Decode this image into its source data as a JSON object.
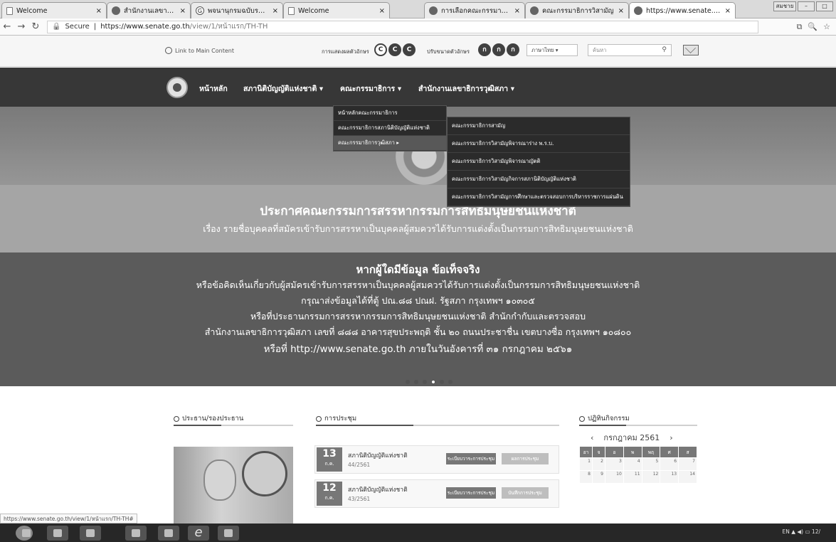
{
  "browser": {
    "tabs": [
      {
        "title": "Welcome",
        "active": false
      },
      {
        "title": "สำนักงานเลขาธิการวุ",
        "active": false
      },
      {
        "title": "พจนานุกรมฉบับราชบัณฑิตฯ",
        "active": false
      },
      {
        "title": "Welcome",
        "active": false
      },
      {
        "title": "การเลือกคณะกรรมาธิการฯ",
        "active": false
      },
      {
        "title": "คณะกรรมาธิการวิสามัญ",
        "active": false
      },
      {
        "title": "https://www.senate.go",
        "active": true
      }
    ],
    "profile_label": "สมชาย",
    "url_secure": "Secure",
    "url_host": "https://www.senate.go.th",
    "url_path": "/view/1/หน้าแรก/TH-TH"
  },
  "util": {
    "skip_link": "Link to Main Content",
    "font_label": "การแสดงผลตัวอักษร",
    "font_btns": [
      "C",
      "C",
      "C"
    ],
    "contrast_label": "ปรับขนาดตัวอักษร",
    "contrast_btns": [
      "ก",
      "ก",
      "ก"
    ],
    "language": "ภาษาไทย",
    "search_placeholder": "ค้นหา"
  },
  "nav": {
    "items": [
      "หน้าหลัก",
      "สภานิติบัญญัติแห่งชาติ ▾",
      "คณะกรรมาธิการ ▾",
      "สำนักงานเลขาธิการวุฒิสภา ▾"
    ]
  },
  "dropdown": {
    "level1": [
      "หน้าหลักคณะกรรมาธิการ",
      "คณะกรรมาธิการสภานิติบัญญัติแห่งชาติ",
      "คณะกรรมาธิการวุฒิสภา ▸"
    ],
    "level2": [
      "คณะกรรมาธิการสามัญ",
      "คณะกรรมาธิการวิสามัญพิจารณาร่าง พ.ร.บ.",
      "คณะกรรมาธิการวิสามัญพิจารณาญัตติ",
      "คณะกรรมาธิการวิสามัญกิจการสภานิติบัญญัติแห่งชาติ",
      "คณะกรรมาธิการวิสามัญการศึกษาและตรวจสอบการบริหารราชการแผ่นดิน"
    ]
  },
  "hero": {
    "title": "ประกาศคณะกรรมการสรรหากรรมการสิทธิมนุษยชนแห่งชาติ",
    "subtitle": "เรื่อง รายชื่อบุคคลที่สมัครเข้ารับการสรรหาเป็นบุคคลผู้สมควรได้รับการแต่งตั้งเป็นกรรมการสิทธิมนุษยชนแห่งชาติ",
    "heading2": "หากผู้ใดมีข้อมูล ข้อเท็จจริง",
    "line1": "หรือข้อคิดเห็นเกี่ยวกับผู้สมัครเข้ารับการสรรหาเป็นบุคคลผู้สมควรได้รับการแต่งตั้งเป็นกรรมการสิทธิมนุษยชนแห่งชาติ",
    "line2": "กรุณาส่งข้อมูลได้ที่ตู้ ปณ.๘๘ ปณฝ. รัฐสภา กรุงเทพฯ ๑๐๓๐๕",
    "line3": "หรือที่ประธานกรรมการสรรหากรรมการสิทธิมนุษยชนแห่งชาติ สำนักกำกับและตรวจสอบ",
    "line4": "สำนักงานเลขาธิการวุฒิสภา เลขที่ ๘๘๘ อาคารสุขประพฤติ ชั้น ๒๐ ถนนประชาชื่น เขตบางซื่อ กรุงเทพฯ ๑๐๘๐๐",
    "line5": "หรือที่ http://www.senate.go.th ภายในวันอังคารที่ ๓๑ กรกฎาคม ๒๕๖๑"
  },
  "sections": {
    "president": "ประธาน/รองประธาน",
    "meetings": "การประชุม",
    "activities": "ปฏิทินกิจกรรม"
  },
  "meetings": [
    {
      "day": "13",
      "dow": "ก.ค.",
      "title": "สภานิติบัญญัติแห่งชาติ",
      "no": "44/2561",
      "btn1": "ระเบียบวาระการประชุม",
      "btn2": "ผลการประชุม"
    },
    {
      "day": "12",
      "dow": "ก.ค.",
      "title": "สภานิติบัญญัติแห่งชาติ",
      "no": "43/2561",
      "btn1": "ระเบียบวาระการประชุม",
      "btn2": "บันทึกการประชุม"
    }
  ],
  "calendar": {
    "month": "กรกฎาคม 2561",
    "prev": "‹",
    "next": "›",
    "headers": [
      "อา",
      "จ",
      "อ",
      "พ",
      "พฤ",
      "ศ",
      "ส"
    ],
    "week1": [
      "1",
      "2",
      "3",
      "4",
      "5",
      "6",
      "7"
    ],
    "week2": [
      "8",
      "9",
      "10",
      "11",
      "12",
      "13",
      "14"
    ]
  },
  "status_url": "https://www.senate.go.th/view/1/หน้าแรก/TH-TH#",
  "tray": {
    "lang": "EN",
    "time": "12/"
  }
}
